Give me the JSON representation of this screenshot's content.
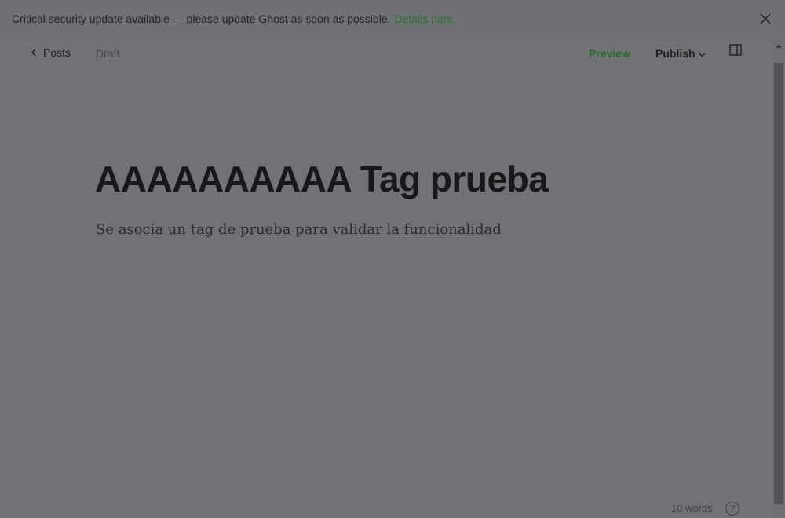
{
  "banner": {
    "message": "Critical security update available — please update Ghost as soon as possible.",
    "link_label": "Details here.",
    "close_icon": "close-icon"
  },
  "toolbar": {
    "back_label": "Posts",
    "back_icon": "chevron-left-icon",
    "status": "Draft",
    "preview_label": "Preview",
    "publish_label": "Publish",
    "publish_icon": "chevron-down-icon",
    "sidebar_icon": "sidebar-toggle-icon"
  },
  "post": {
    "title": "AAAAAAAAAA Tag prueba",
    "excerpt": "Se asocia un tag de prueba para validar la funcionalidad"
  },
  "footer": {
    "word_count": "10 words",
    "help_label": "?"
  },
  "colors": {
    "overlay_bg": "#707275",
    "accent_green": "#2b6a31"
  }
}
